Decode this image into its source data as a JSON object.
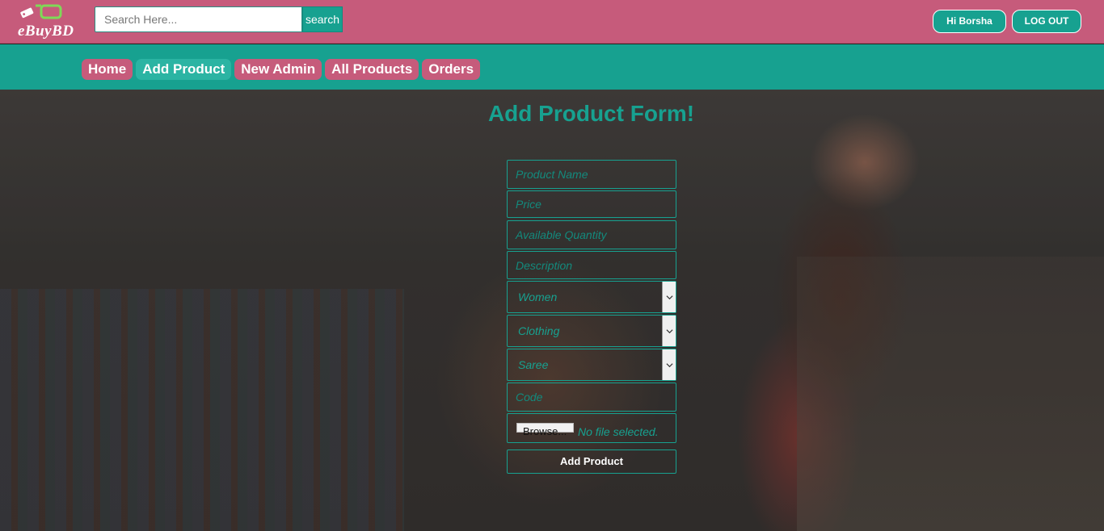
{
  "header": {
    "logo_text": "eBuyBD",
    "search": {
      "placeholder": "Search Here...",
      "value": "",
      "button_label": "search"
    },
    "user_label": "Hi Borsha",
    "logout_label": "LOG OUT"
  },
  "nav": {
    "items": [
      {
        "label": "Home",
        "active": false
      },
      {
        "label": "Add Product",
        "active": true
      },
      {
        "label": "New Admin",
        "active": false
      },
      {
        "label": "All Products",
        "active": false
      },
      {
        "label": "Orders",
        "active": false
      }
    ]
  },
  "form": {
    "title": "Add Product Form!",
    "product_name_placeholder": "Product Name",
    "price_placeholder": "Price",
    "quantity_placeholder": "Available Quantity",
    "description_placeholder": "Description",
    "category_selected": "Women",
    "subcategory_selected": "Clothing",
    "type_selected": "Saree",
    "code_placeholder": "Code",
    "browse_label": "Browse...",
    "file_status": "No file selected.",
    "submit_label": "Add Product"
  },
  "colors": {
    "header_pink": "#c65b7b",
    "teal": "#17a190",
    "active_tab": "#2bb4a3",
    "white": "#ffffff"
  },
  "icons": {
    "logo": "shopping-cart-tag-icon",
    "select_caret": "chevron-down-icon"
  }
}
